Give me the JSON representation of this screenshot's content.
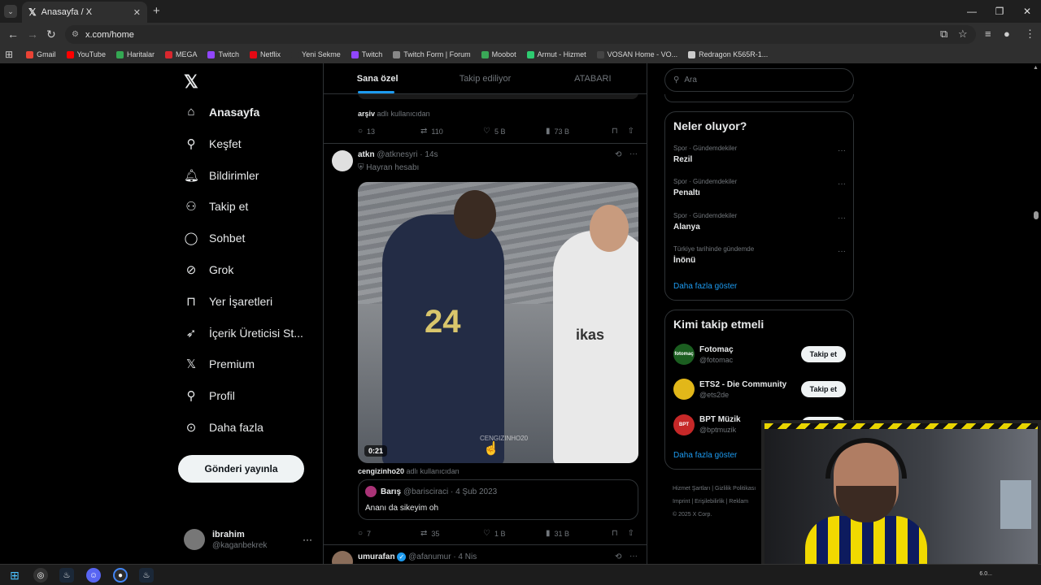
{
  "browser": {
    "tab_title": "Anasayfa / X",
    "url": "x.com/home",
    "bookmarks": [
      {
        "label": "Gmail",
        "color": "#ea4335"
      },
      {
        "label": "YouTube",
        "color": "#ff0000"
      },
      {
        "label": "Haritalar",
        "color": "#34a853"
      },
      {
        "label": "MEGA",
        "color": "#d9272e"
      },
      {
        "label": "Twitch",
        "color": "#9146ff"
      },
      {
        "label": "Netflix",
        "color": "#e50914"
      },
      {
        "label": "Yeni Sekme",
        "color": "#2f2f2f"
      },
      {
        "label": "Twitch",
        "color": "#9146ff"
      },
      {
        "label": "Twitch Form | Forum",
        "color": "#888888"
      },
      {
        "label": "Moobot",
        "color": "#3aa757"
      },
      {
        "label": "Armut - Hizmet",
        "color": "#2ecc71"
      },
      {
        "label": "VOSAN Home - VO...",
        "color": "#444444"
      },
      {
        "label": "Redragon K565R-1...",
        "color": "#cccccc"
      }
    ]
  },
  "nav": {
    "items": [
      {
        "label": "Anasayfa",
        "icon": "home-icon"
      },
      {
        "label": "Keşfet",
        "icon": "search-icon"
      },
      {
        "label": "Bildirimler",
        "icon": "bell-icon"
      },
      {
        "label": "Takip et",
        "icon": "person-add-icon"
      },
      {
        "label": "Sohbet",
        "icon": "chat-icon"
      },
      {
        "label": "Grok",
        "icon": "grok-icon"
      },
      {
        "label": "Yer İşaretleri",
        "icon": "bookmark-icon"
      },
      {
        "label": "İçerik Üreticisi St...",
        "icon": "rocket-icon"
      },
      {
        "label": "Premium",
        "icon": "x-icon"
      },
      {
        "label": "Profil",
        "icon": "person-icon"
      },
      {
        "label": "Daha fazla",
        "icon": "more-circle-icon"
      }
    ],
    "post_button": "Gönderi yayınla",
    "account_name": "ibrahim",
    "account_handle": "@kaganbekrek"
  },
  "feed": {
    "tabs": [
      "Sana özel",
      "Takip ediliyor",
      "ATABARI"
    ],
    "prev_from": "arşiv",
    "prev_from_suffix": "adlı kullanıcıdan",
    "prev_actions": {
      "replies": "13",
      "reposts": "110",
      "likes": "5 B",
      "views": "73 B"
    },
    "tweet": {
      "name": "atkn",
      "handle": "@atknesyri",
      "time": "· 14s",
      "badge": "Hayran hesabı",
      "duration": "0:21",
      "watermark": "CENGIZINHO20",
      "from": "cengizinho20",
      "from_suffix": "adlı kullanıcıdan",
      "quote_name": "Barış",
      "quote_handle": "@barisciraci",
      "quote_time": "· 4 Şub 2023",
      "quote_text": "Ananı da sikeyim oh",
      "actions": {
        "replies": "7",
        "reposts": "35",
        "likes": "1 B",
        "views": "31 B"
      }
    },
    "next": {
      "name": "umurafan",
      "handle": "@afanumur",
      "time": "· 4 Nis"
    }
  },
  "right": {
    "search_placeholder": "Ara",
    "trends_title": "Neler oluyor?",
    "trends": [
      {
        "cat": "Spor · Gündemdekiler",
        "title": "Rezil"
      },
      {
        "cat": "Spor · Gündemdekiler",
        "title": "Penaltı"
      },
      {
        "cat": "Spor · Gündemdekiler",
        "title": "Alanya"
      },
      {
        "cat": "Türkiye tarihinde gündemde",
        "title": "İnönü"
      }
    ],
    "show_more": "Daha fazla göster",
    "who_title": "Kimi takip etmeli",
    "who": [
      {
        "name": "Fotomaç",
        "handle": "@fotomac",
        "avatar_text": "fotomaç",
        "color": "#1b5e20"
      },
      {
        "name": "ETS2 - Die Community",
        "handle": "@ets2de",
        "avatar_text": "",
        "color": "#e2b719"
      },
      {
        "name": "BPT Müzik",
        "handle": "@bptmuzik",
        "avatar_text": "BPT",
        "color": "#c62828"
      }
    ],
    "follow_label": "Takip et",
    "who_show_more": "Daha fazla göster",
    "footer": [
      "Hizmet Şartları",
      "Gizlilik Politikası",
      "Imprint",
      "Erişilebilirlik",
      "Reklam",
      "© 2025 X Corp."
    ]
  }
}
